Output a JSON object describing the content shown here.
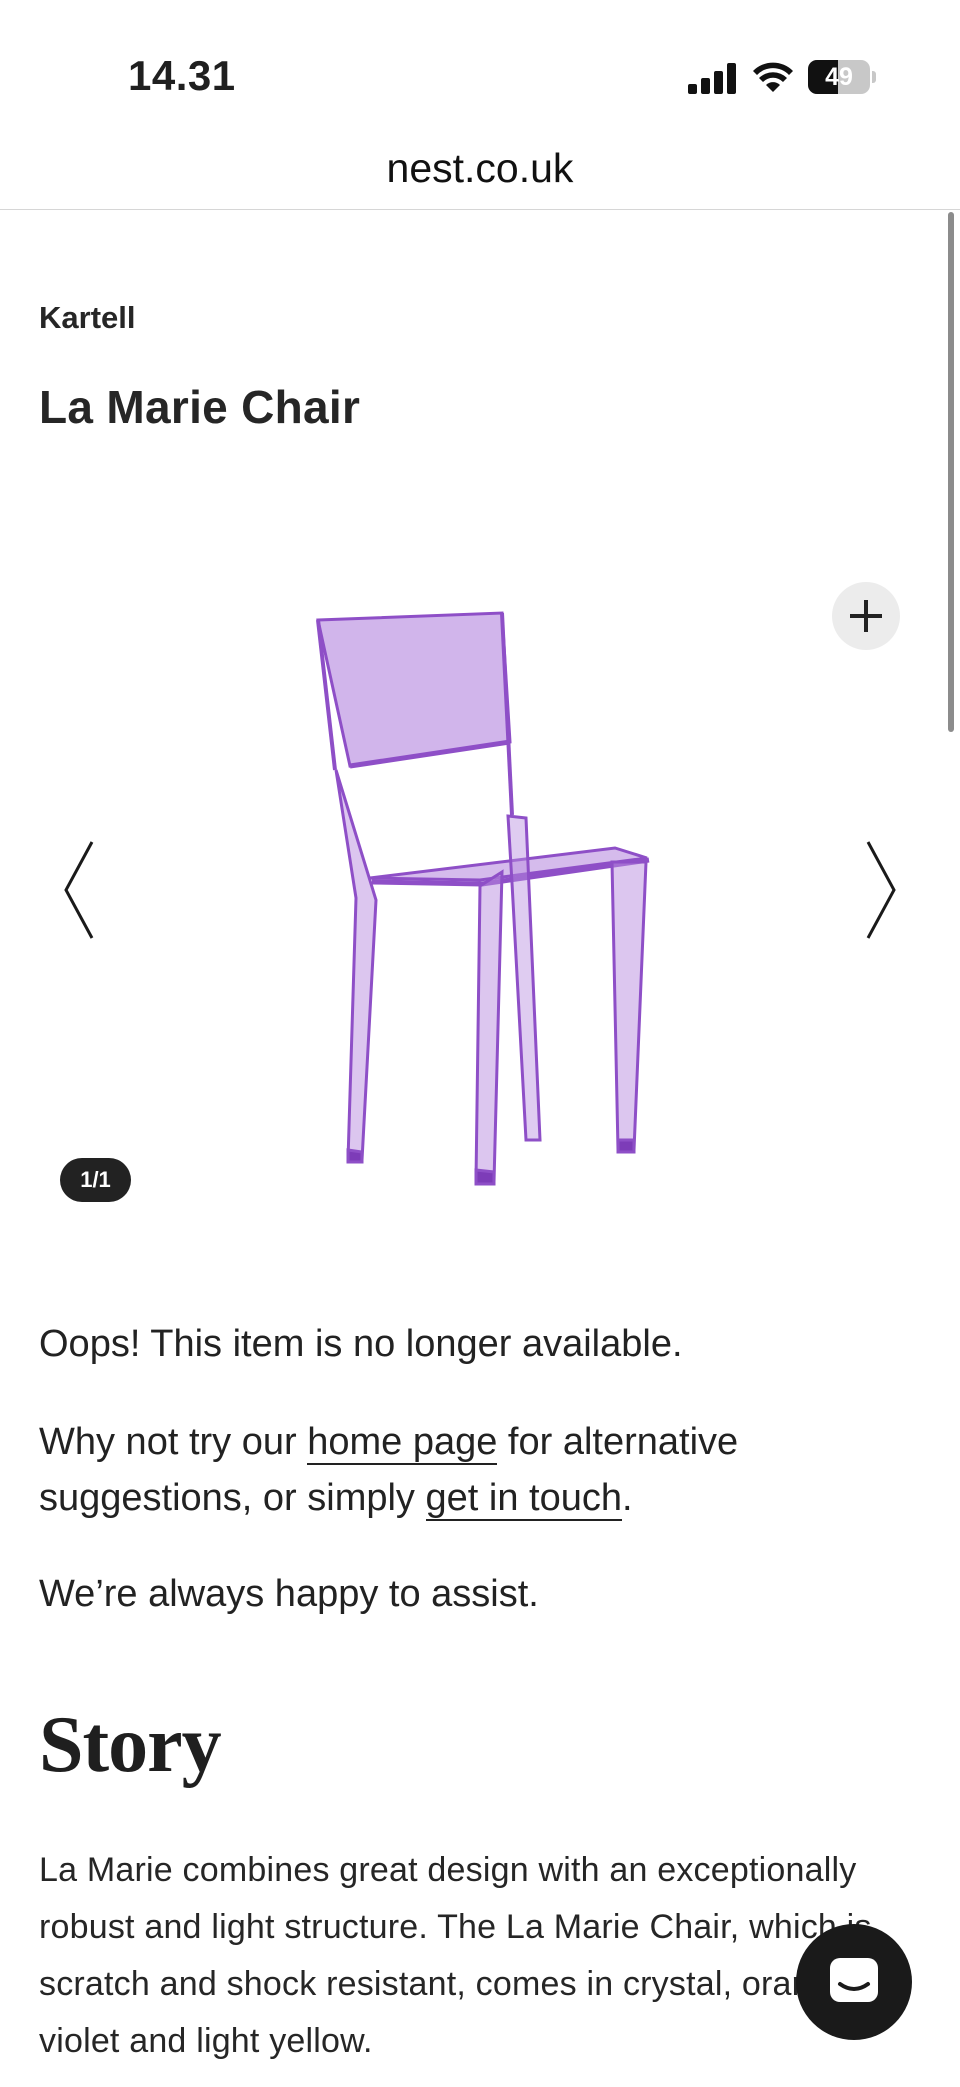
{
  "status_bar": {
    "time": "14.31",
    "battery_level": "49",
    "icons": [
      "signal-icon",
      "wifi-icon",
      "battery-icon"
    ]
  },
  "browser": {
    "url": "nest.co.uk"
  },
  "product": {
    "brand": "Kartell",
    "title": "La Marie Chair",
    "image_counter": "1/1",
    "chair_color": "#b98ee0"
  },
  "availability": {
    "oops": "Oops! This item is no longer available.",
    "try_prefix": "Why not try our ",
    "home_link": "home page",
    "try_middle": " for alternative suggestions, or simply ",
    "contact_link": "get in touch",
    "try_suffix": ".",
    "assist": "We’re always happy to assist."
  },
  "story": {
    "heading": "Story",
    "text": "La Marie combines great design with an exceptionally robust and light structure. The La Marie Chair, which is scratch and shock resistant, comes in crystal, orange, violet and light yellow."
  },
  "icons": {
    "zoom": "plus-icon",
    "prev": "chevron-left-icon",
    "next": "chevron-right-icon",
    "chat": "chat-icon"
  }
}
